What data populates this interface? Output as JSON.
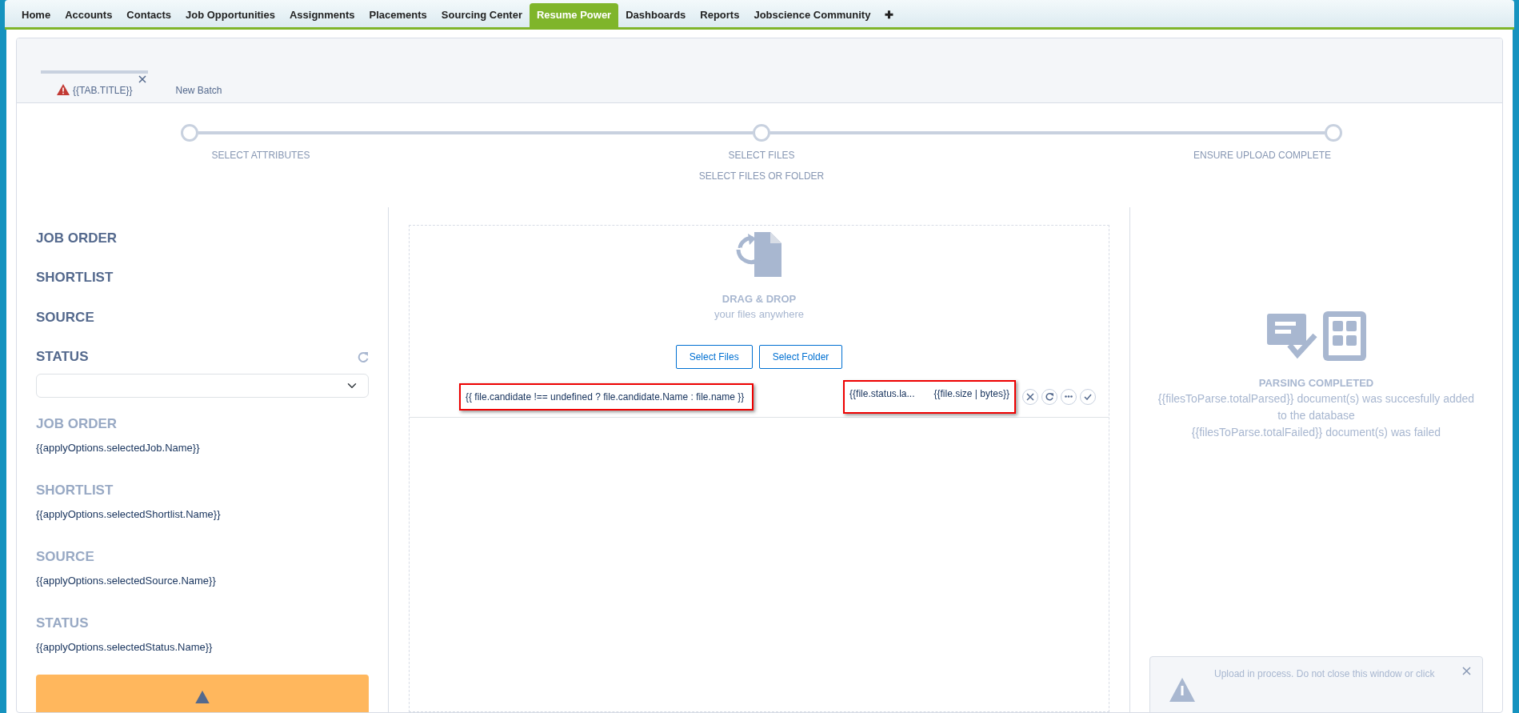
{
  "nav_tabs": [
    {
      "label": "Home",
      "selected": false
    },
    {
      "label": "Accounts",
      "selected": false
    },
    {
      "label": "Contacts",
      "selected": false
    },
    {
      "label": "Job Opportunities",
      "selected": false
    },
    {
      "label": "Assignments",
      "selected": false
    },
    {
      "label": "Placements",
      "selected": false
    },
    {
      "label": "Sourcing Center",
      "selected": false
    },
    {
      "label": "Resume Power",
      "selected": true
    },
    {
      "label": "Dashboards",
      "selected": false
    },
    {
      "label": "Reports",
      "selected": false
    },
    {
      "label": "Jobscience Community",
      "selected": false
    },
    {
      "label": "✚",
      "selected": false
    }
  ],
  "batch_tabs": [
    {
      "label": "{{TAB.TITLE}}",
      "selected": true,
      "warning": true,
      "closable": true
    },
    {
      "label": "New Batch",
      "selected": false,
      "warning": false,
      "closable": false
    }
  ],
  "steps": [
    {
      "label": "SELECT ATTRIBUTES"
    },
    {
      "label": "SELECT FILES",
      "sublabel": "SELECT FILES OR FOLDER"
    },
    {
      "label": "ENSURE UPLOAD COMPLETE"
    }
  ],
  "attributes": {
    "headings": [
      "JOB ORDER",
      "SHORTLIST",
      "SOURCE",
      "STATUS"
    ],
    "summary": [
      {
        "label": "JOB ORDER",
        "value": "{{applyOptions.selectedJob.Name}}"
      },
      {
        "label": "SHORTLIST",
        "value": "{{applyOptions.selectedShortlist.Name}}"
      },
      {
        "label": "SOURCE",
        "value": "{{applyOptions.selectedSource.Name}}"
      },
      {
        "label": "STATUS",
        "value": "{{applyOptions.selectedStatus.Name}}"
      }
    ]
  },
  "dropzone": {
    "title": "DRAG & DROP",
    "subtitle": "your files anywhere",
    "buttons": [
      "Select Files",
      "Select Folder"
    ],
    "files": [
      {
        "name": "{{ file.candidate !== undefined ? file.candidate.Name : file.name }}",
        "status": "{{file.status.la...",
        "size": "{{file.size | bytes}}",
        "highlighted": true
      }
    ]
  },
  "result": {
    "title": "PARSING COMPLETED",
    "lines": [
      "{{filesToParse.totalParsed}} document(s) was succesfully added to the database",
      "{{filesToParse.totalFailed}} document(s) was failed"
    ]
  },
  "alert": {
    "text": "Upload in process. Do not close this window or click"
  }
}
